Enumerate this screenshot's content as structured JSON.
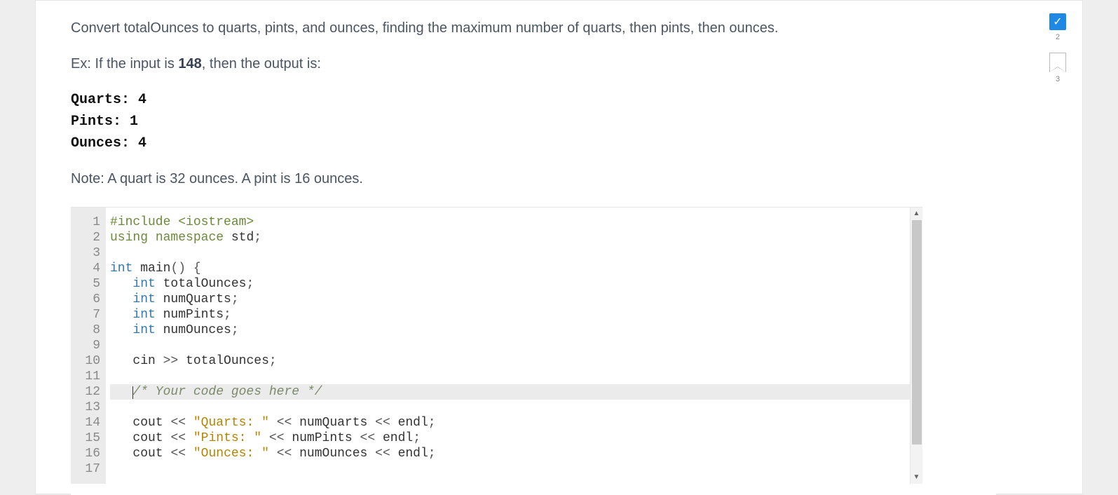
{
  "problem": {
    "intro": "Convert totalOunces to quarts, pints, and ounces, finding the maximum number of quarts, then pints, then ounces.",
    "example_prefix": "Ex: If the input is ",
    "example_input": "148",
    "example_suffix": ", then the output is:",
    "output_lines": [
      "Quarts: 4",
      "Pints: 1",
      "Ounces: 4"
    ],
    "note": "Note: A quart is 32 ounces. A pint is 16 ounces."
  },
  "code": {
    "lines": [
      {
        "n": 1,
        "tokens": [
          [
            "pp",
            "#include <iostream>"
          ]
        ]
      },
      {
        "n": 2,
        "tokens": [
          [
            "kw",
            "using"
          ],
          [
            "sp",
            " "
          ],
          [
            "kw",
            "namespace"
          ],
          [
            "sp",
            " "
          ],
          [
            "id",
            "std"
          ],
          [
            "op",
            ";"
          ]
        ]
      },
      {
        "n": 3,
        "tokens": []
      },
      {
        "n": 4,
        "tokens": [
          [
            "type",
            "int"
          ],
          [
            "sp",
            " "
          ],
          [
            "id",
            "main"
          ],
          [
            "op",
            "() {"
          ]
        ]
      },
      {
        "n": 5,
        "tokens": [
          [
            "sp",
            "   "
          ],
          [
            "type",
            "int"
          ],
          [
            "sp",
            " "
          ],
          [
            "id",
            "totalOunces"
          ],
          [
            "op",
            ";"
          ]
        ]
      },
      {
        "n": 6,
        "tokens": [
          [
            "sp",
            "   "
          ],
          [
            "type",
            "int"
          ],
          [
            "sp",
            " "
          ],
          [
            "id",
            "numQuarts"
          ],
          [
            "op",
            ";"
          ]
        ]
      },
      {
        "n": 7,
        "tokens": [
          [
            "sp",
            "   "
          ],
          [
            "type",
            "int"
          ],
          [
            "sp",
            " "
          ],
          [
            "id",
            "numPints"
          ],
          [
            "op",
            ";"
          ]
        ]
      },
      {
        "n": 8,
        "tokens": [
          [
            "sp",
            "   "
          ],
          [
            "type",
            "int"
          ],
          [
            "sp",
            " "
          ],
          [
            "id",
            "numOunces"
          ],
          [
            "op",
            ";"
          ]
        ]
      },
      {
        "n": 9,
        "tokens": []
      },
      {
        "n": 10,
        "tokens": [
          [
            "sp",
            "   "
          ],
          [
            "id",
            "cin"
          ],
          [
            "sp",
            " "
          ],
          [
            "op",
            ">>"
          ],
          [
            "sp",
            " "
          ],
          [
            "id",
            "totalOunces"
          ],
          [
            "op",
            ";"
          ]
        ]
      },
      {
        "n": 11,
        "tokens": []
      },
      {
        "n": 12,
        "highlight": true,
        "cursor": true,
        "tokens": [
          [
            "sp",
            "   "
          ],
          [
            "cmt",
            "/* Your code goes here */"
          ]
        ]
      },
      {
        "n": 13,
        "tokens": []
      },
      {
        "n": 14,
        "tokens": [
          [
            "sp",
            "   "
          ],
          [
            "id",
            "cout"
          ],
          [
            "sp",
            " "
          ],
          [
            "op",
            "<<"
          ],
          [
            "sp",
            " "
          ],
          [
            "str",
            "\"Quarts: \""
          ],
          [
            "sp",
            " "
          ],
          [
            "op",
            "<<"
          ],
          [
            "sp",
            " "
          ],
          [
            "id",
            "numQuarts"
          ],
          [
            "sp",
            " "
          ],
          [
            "op",
            "<<"
          ],
          [
            "sp",
            " "
          ],
          [
            "id",
            "endl"
          ],
          [
            "op",
            ";"
          ]
        ]
      },
      {
        "n": 15,
        "tokens": [
          [
            "sp",
            "   "
          ],
          [
            "id",
            "cout"
          ],
          [
            "sp",
            " "
          ],
          [
            "op",
            "<<"
          ],
          [
            "sp",
            " "
          ],
          [
            "str",
            "\"Pints: \""
          ],
          [
            "sp",
            " "
          ],
          [
            "op",
            "<<"
          ],
          [
            "sp",
            " "
          ],
          [
            "id",
            "numPints"
          ],
          [
            "sp",
            " "
          ],
          [
            "op",
            "<<"
          ],
          [
            "sp",
            " "
          ],
          [
            "id",
            "endl"
          ],
          [
            "op",
            ";"
          ]
        ]
      },
      {
        "n": 16,
        "tokens": [
          [
            "sp",
            "   "
          ],
          [
            "id",
            "cout"
          ],
          [
            "sp",
            " "
          ],
          [
            "op",
            "<<"
          ],
          [
            "sp",
            " "
          ],
          [
            "str",
            "\"Ounces: \""
          ],
          [
            "sp",
            " "
          ],
          [
            "op",
            "<<"
          ],
          [
            "sp",
            " "
          ],
          [
            "id",
            "numOunces"
          ],
          [
            "sp",
            " "
          ],
          [
            "op",
            "<<"
          ],
          [
            "sp",
            " "
          ],
          [
            "id",
            "endl"
          ],
          [
            "op",
            ";"
          ]
        ]
      },
      {
        "n": 17,
        "tokens": []
      }
    ]
  },
  "side": {
    "count1": "2",
    "count2": "3"
  }
}
